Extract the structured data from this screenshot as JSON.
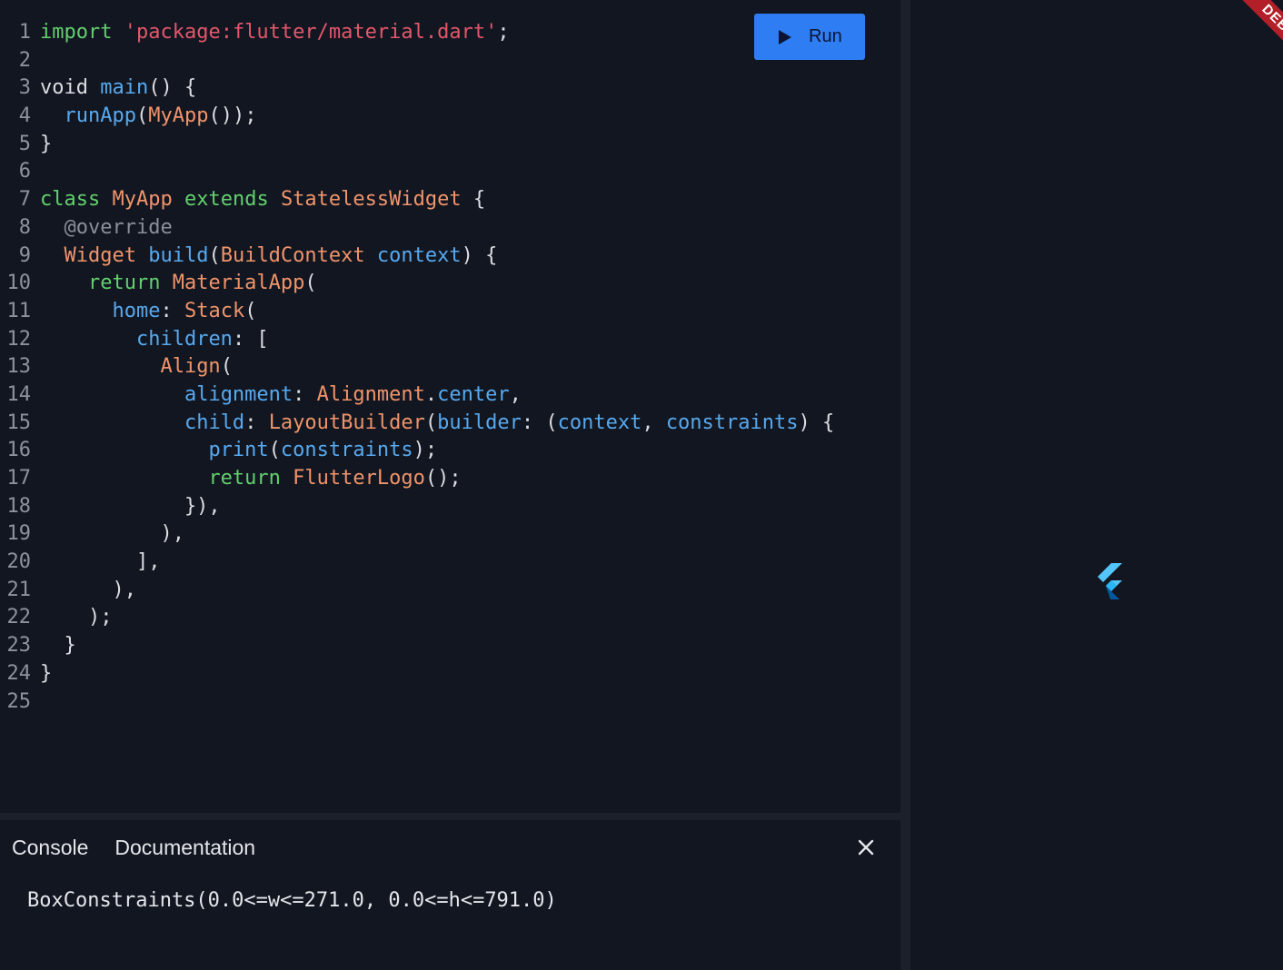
{
  "toolbar": {
    "run_label": "Run"
  },
  "editor": {
    "lines": [
      {
        "n": "1",
        "tokens": [
          {
            "t": "import",
            "c": "kw"
          },
          {
            "t": " ",
            "c": "pl"
          },
          {
            "t": "'package:flutter/material.dart'",
            "c": "str"
          },
          {
            "t": ";",
            "c": "pl"
          }
        ]
      },
      {
        "n": "2",
        "tokens": []
      },
      {
        "n": "3",
        "tokens": [
          {
            "t": "void ",
            "c": "pl"
          },
          {
            "t": "main",
            "c": "fn"
          },
          {
            "t": "() {",
            "c": "pl"
          }
        ]
      },
      {
        "n": "4",
        "tokens": [
          {
            "t": "  ",
            "c": "pl"
          },
          {
            "t": "runApp",
            "c": "fn"
          },
          {
            "t": "(",
            "c": "pl"
          },
          {
            "t": "MyApp",
            "c": "type"
          },
          {
            "t": "());",
            "c": "pl"
          }
        ]
      },
      {
        "n": "5",
        "tokens": [
          {
            "t": "}",
            "c": "pl"
          }
        ]
      },
      {
        "n": "6",
        "tokens": []
      },
      {
        "n": "7",
        "tokens": [
          {
            "t": "class ",
            "c": "kw"
          },
          {
            "t": "MyApp ",
            "c": "type"
          },
          {
            "t": "extends ",
            "c": "kw"
          },
          {
            "t": "StatelessWidget",
            "c": "type"
          },
          {
            "t": " {",
            "c": "pl"
          }
        ]
      },
      {
        "n": "8",
        "tokens": [
          {
            "t": "  ",
            "c": "pl"
          },
          {
            "t": "@override",
            "c": "ann"
          }
        ]
      },
      {
        "n": "9",
        "tokens": [
          {
            "t": "  ",
            "c": "pl"
          },
          {
            "t": "Widget ",
            "c": "type"
          },
          {
            "t": "build",
            "c": "fn"
          },
          {
            "t": "(",
            "c": "pl"
          },
          {
            "t": "BuildContext ",
            "c": "type"
          },
          {
            "t": "context",
            "c": "fn"
          },
          {
            "t": ") {",
            "c": "pl"
          }
        ]
      },
      {
        "n": "10",
        "tokens": [
          {
            "t": "    ",
            "c": "pl"
          },
          {
            "t": "return ",
            "c": "kw"
          },
          {
            "t": "MaterialApp",
            "c": "type"
          },
          {
            "t": "(",
            "c": "pl"
          }
        ]
      },
      {
        "n": "11",
        "tokens": [
          {
            "t": "      ",
            "c": "pl"
          },
          {
            "t": "home",
            "c": "fn"
          },
          {
            "t": ": ",
            "c": "pl"
          },
          {
            "t": "Stack",
            "c": "type"
          },
          {
            "t": "(",
            "c": "pl"
          }
        ]
      },
      {
        "n": "12",
        "tokens": [
          {
            "t": "        ",
            "c": "pl"
          },
          {
            "t": "children",
            "c": "fn"
          },
          {
            "t": ": [",
            "c": "pl"
          }
        ]
      },
      {
        "n": "13",
        "tokens": [
          {
            "t": "          ",
            "c": "pl"
          },
          {
            "t": "Align",
            "c": "type"
          },
          {
            "t": "(",
            "c": "pl"
          }
        ]
      },
      {
        "n": "14",
        "tokens": [
          {
            "t": "            ",
            "c": "pl"
          },
          {
            "t": "alignment",
            "c": "fn"
          },
          {
            "t": ": ",
            "c": "pl"
          },
          {
            "t": "Alignment",
            "c": "type"
          },
          {
            "t": ".",
            "c": "pl"
          },
          {
            "t": "center",
            "c": "fn"
          },
          {
            "t": ",",
            "c": "pl"
          }
        ]
      },
      {
        "n": "15",
        "tokens": [
          {
            "t": "            ",
            "c": "pl"
          },
          {
            "t": "child",
            "c": "fn"
          },
          {
            "t": ": ",
            "c": "pl"
          },
          {
            "t": "LayoutBuilder",
            "c": "type"
          },
          {
            "t": "(",
            "c": "pl"
          },
          {
            "t": "builder",
            "c": "fn"
          },
          {
            "t": ": (",
            "c": "pl"
          },
          {
            "t": "context",
            "c": "fn"
          },
          {
            "t": ", ",
            "c": "pl"
          },
          {
            "t": "constraints",
            "c": "fn"
          },
          {
            "t": ") {",
            "c": "pl"
          }
        ]
      },
      {
        "n": "16",
        "tokens": [
          {
            "t": "              ",
            "c": "pl"
          },
          {
            "t": "print",
            "c": "fn"
          },
          {
            "t": "(",
            "c": "pl"
          },
          {
            "t": "constraints",
            "c": "fn"
          },
          {
            "t": ");",
            "c": "pl"
          }
        ]
      },
      {
        "n": "17",
        "tokens": [
          {
            "t": "              ",
            "c": "pl"
          },
          {
            "t": "return ",
            "c": "kw"
          },
          {
            "t": "FlutterLogo",
            "c": "type"
          },
          {
            "t": "();",
            "c": "pl"
          }
        ]
      },
      {
        "n": "18",
        "tokens": [
          {
            "t": "            }),",
            "c": "pl"
          }
        ]
      },
      {
        "n": "19",
        "tokens": [
          {
            "t": "          ),",
            "c": "pl"
          }
        ]
      },
      {
        "n": "20",
        "tokens": [
          {
            "t": "        ],",
            "c": "pl"
          }
        ]
      },
      {
        "n": "21",
        "tokens": [
          {
            "t": "      ),",
            "c": "pl"
          }
        ]
      },
      {
        "n": "22",
        "tokens": [
          {
            "t": "    );",
            "c": "pl"
          }
        ]
      },
      {
        "n": "23",
        "tokens": [
          {
            "t": "  }",
            "c": "pl"
          }
        ]
      },
      {
        "n": "24",
        "tokens": [
          {
            "t": "}",
            "c": "pl"
          }
        ]
      },
      {
        "n": "25",
        "tokens": []
      }
    ]
  },
  "bottom_panel": {
    "tabs": [
      {
        "label": "Console"
      },
      {
        "label": "Documentation"
      }
    ],
    "close_icon": "close-icon",
    "console_output": "BoxConstraints(0.0<=w<=271.0, 0.0<=h<=791.0)"
  },
  "preview": {
    "debug_banner": "DEBUG",
    "logo_icon": "flutter-logo-icon"
  },
  "colors": {
    "background": "#121621",
    "accent": "#2f7df2",
    "keyword": "#62d06d",
    "type": "#f0946a",
    "identifier": "#57a9ef",
    "string": "#e3576a",
    "annotation": "#8a8f99",
    "debug_banner": "#b21f28"
  }
}
